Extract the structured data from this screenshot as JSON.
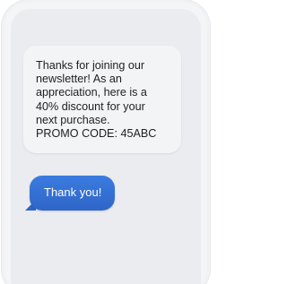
{
  "messages": {
    "incoming": {
      "lines": [
        "Thanks for joining our",
        "newsletter! As an",
        "appreciation, here is a",
        "40% discount for your",
        "next purchase.",
        "PROMO CODE: 45ABC"
      ]
    },
    "outgoing": {
      "text": "Thank you!"
    }
  },
  "colors": {
    "outgoing_bubble": "#3b7be0",
    "incoming_bubble": "#f3f4f6",
    "screen_background": "#ebecef"
  }
}
